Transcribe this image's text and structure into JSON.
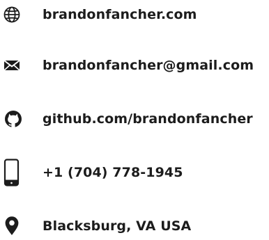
{
  "contacts": {
    "website": {
      "label": "brandonfancher.com",
      "icon": "globe-icon"
    },
    "email": {
      "label": "brandonfancher@gmail.com",
      "icon": "envelope-icon"
    },
    "github": {
      "label": "github.com/brandonfancher",
      "icon": "github-icon"
    },
    "phone": {
      "label": "+1 (704) 778-1945",
      "icon": "mobile-phone-icon"
    },
    "location": {
      "label": "Blacksburg, VA USA",
      "icon": "map-pin-icon"
    }
  },
  "colors": {
    "text": "#1c1c1c",
    "icon": "#1c1c1c",
    "background": "#ffffff"
  }
}
